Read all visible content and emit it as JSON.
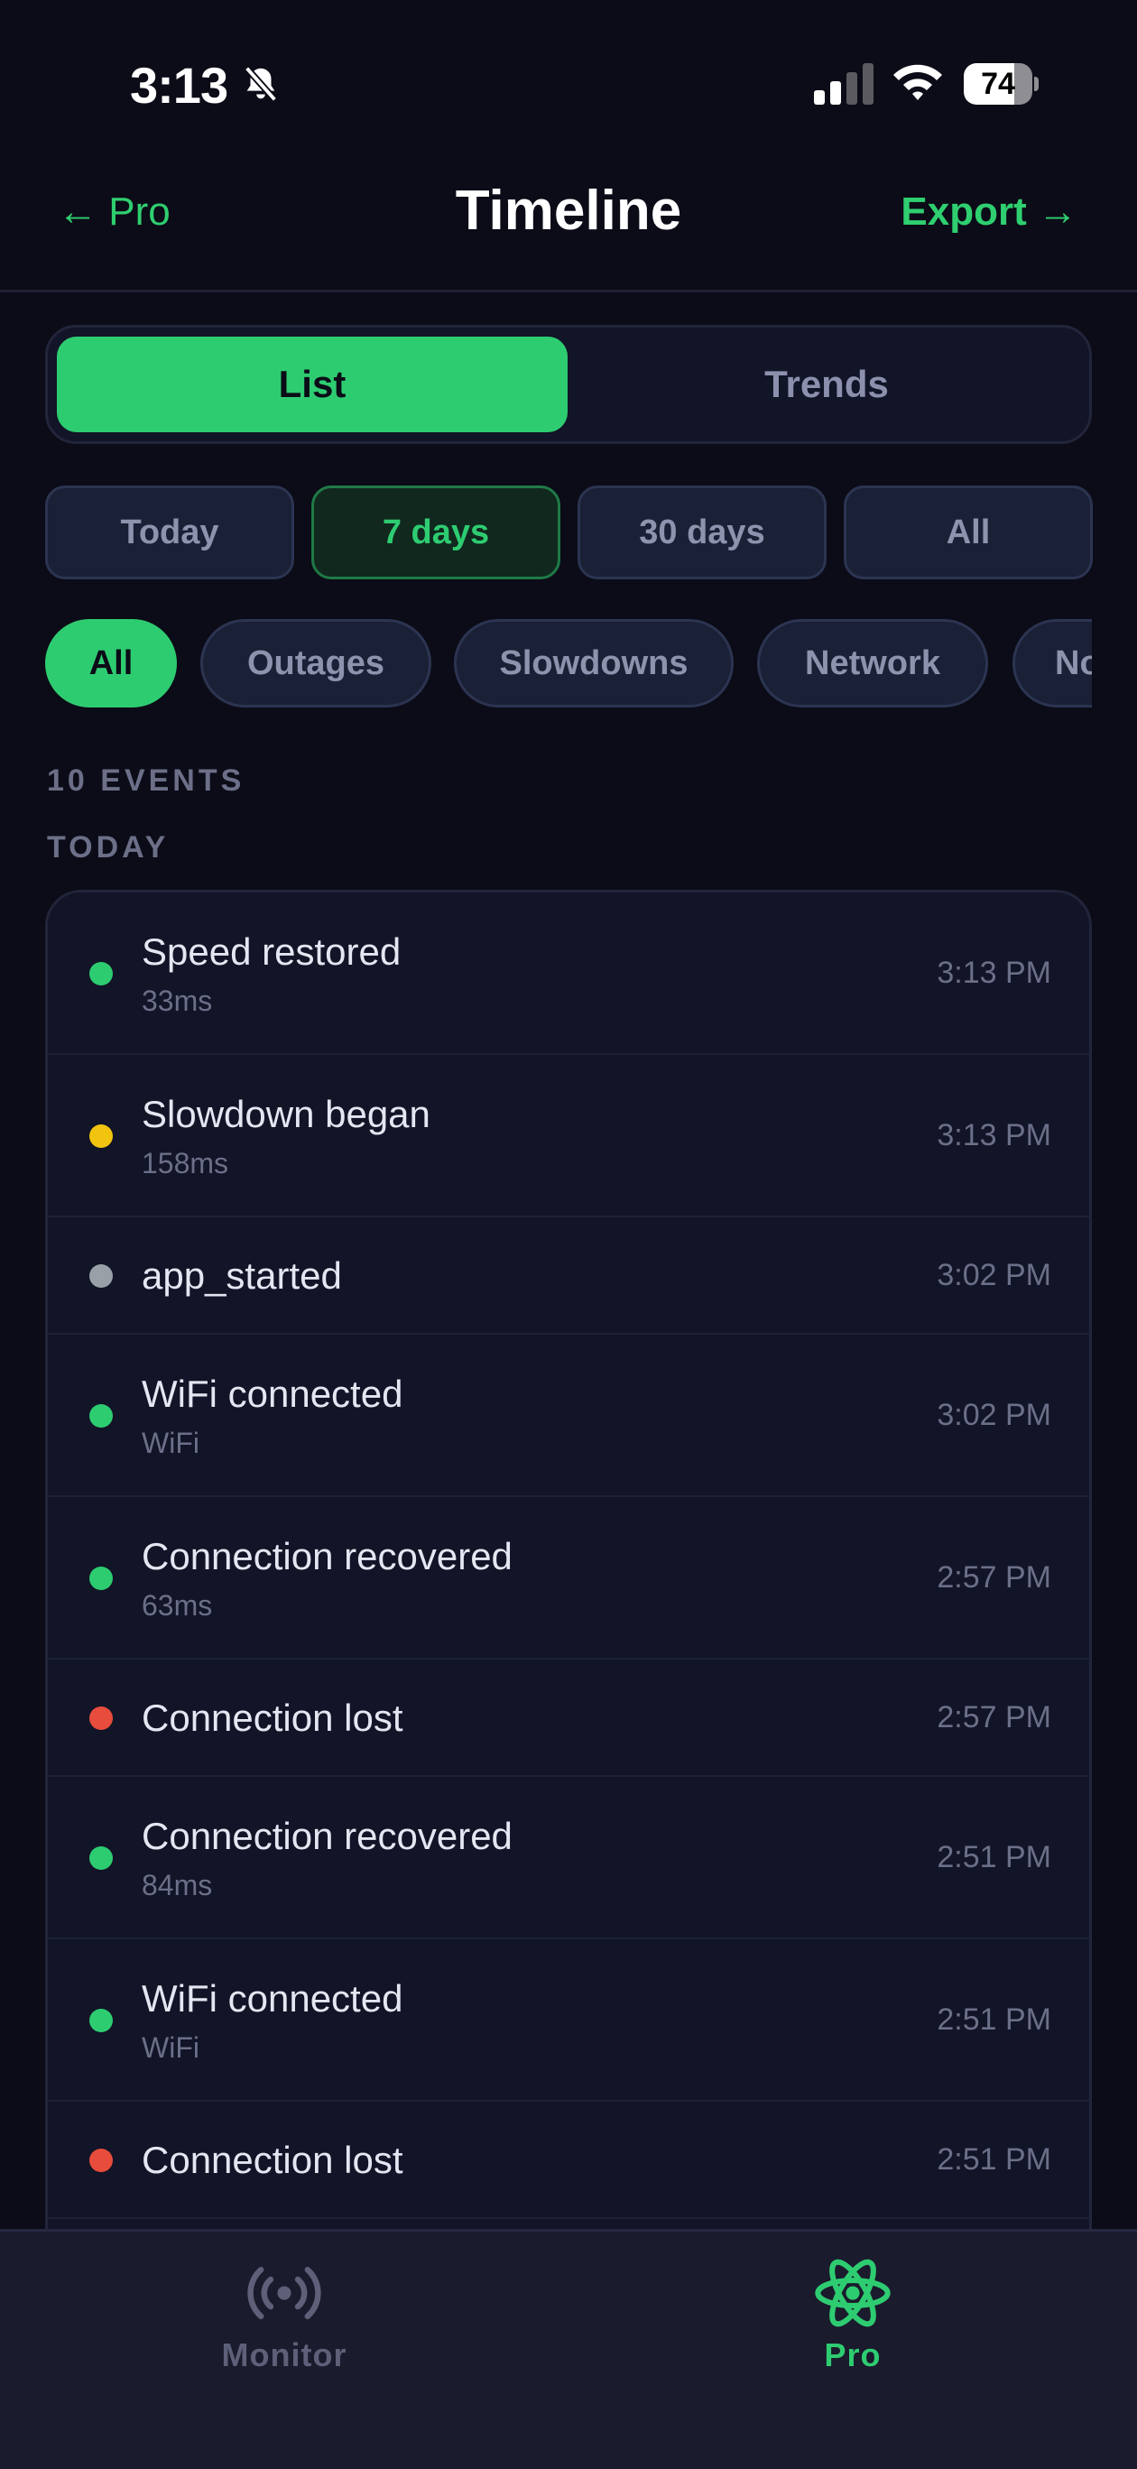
{
  "status_bar": {
    "time": "3:13",
    "battery": "74",
    "battery_level": 0.74
  },
  "nav": {
    "back_label": "← Pro",
    "title": "Timeline",
    "export_label": "Export →"
  },
  "view_toggle": {
    "options": [
      "List",
      "Trends"
    ],
    "selected": "List"
  },
  "range_filters": {
    "options": [
      "Today",
      "7 days",
      "30 days",
      "All"
    ],
    "selected": "7 days"
  },
  "type_filters": {
    "options": [
      "All",
      "Outages",
      "Slowdowns",
      "Network",
      "No"
    ],
    "selected": "All"
  },
  "event_count_label": "10 EVENTS",
  "group_label": "TODAY",
  "events": [
    {
      "title": "Speed restored",
      "subtitle": "33ms",
      "time": "3:13 PM",
      "status": "success"
    },
    {
      "title": "Slowdown began",
      "subtitle": "158ms",
      "time": "3:13 PM",
      "status": "warning"
    },
    {
      "title": "app_started",
      "subtitle": "",
      "time": "3:02 PM",
      "status": "neutral"
    },
    {
      "title": "WiFi connected",
      "subtitle": "WiFi",
      "time": "3:02 PM",
      "status": "success"
    },
    {
      "title": "Connection recovered",
      "subtitle": "63ms",
      "time": "2:57 PM",
      "status": "success"
    },
    {
      "title": "Connection lost",
      "subtitle": "",
      "time": "2:57 PM",
      "status": "error"
    },
    {
      "title": "Connection recovered",
      "subtitle": "84ms",
      "time": "2:51 PM",
      "status": "success"
    },
    {
      "title": "WiFi connected",
      "subtitle": "WiFi",
      "time": "2:51 PM",
      "status": "success"
    },
    {
      "title": "Connection lost",
      "subtitle": "",
      "time": "2:51 PM",
      "status": "error"
    }
  ],
  "status_colors": {
    "success": "#2ecc71",
    "warning": "#f1c40f",
    "neutral": "#9aa0a8",
    "error": "#e74c3c"
  },
  "tab_bar": {
    "monitor": {
      "label": "Monitor",
      "icon": "broadcast-icon",
      "color": "#5d6078"
    },
    "pro": {
      "label": "Pro",
      "icon": "atom-icon",
      "color": "#2ecc71"
    }
  }
}
